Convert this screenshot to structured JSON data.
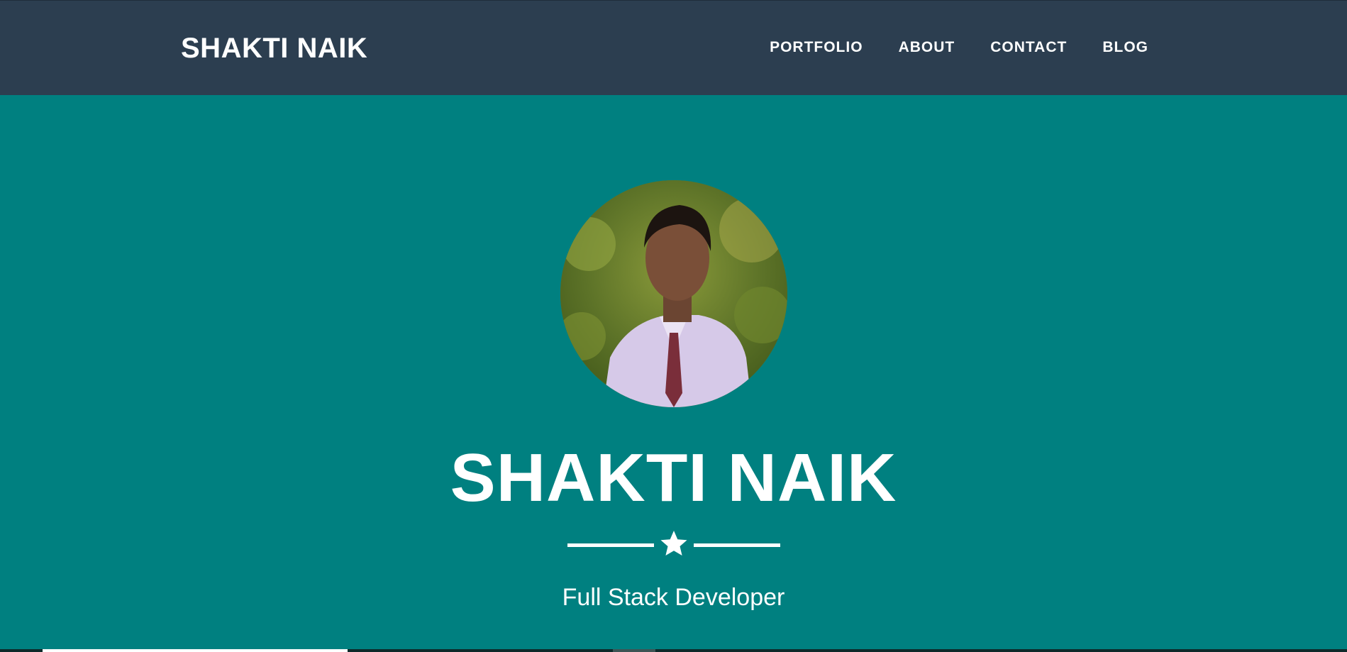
{
  "navbar": {
    "brand": "SHAKTI NAIK",
    "links": [
      {
        "label": "PORTFOLIO"
      },
      {
        "label": "ABOUT"
      },
      {
        "label": "CONTACT"
      },
      {
        "label": "BLOG"
      }
    ]
  },
  "hero": {
    "avatar_icon": "profile-photo",
    "name": "SHAKTI NAIK",
    "divider_icon": "star-icon",
    "tagline": "Full Stack Developer"
  },
  "colors": {
    "navbar_bg": "#2c3e50",
    "hero_bg": "#008080",
    "text": "#ffffff"
  }
}
